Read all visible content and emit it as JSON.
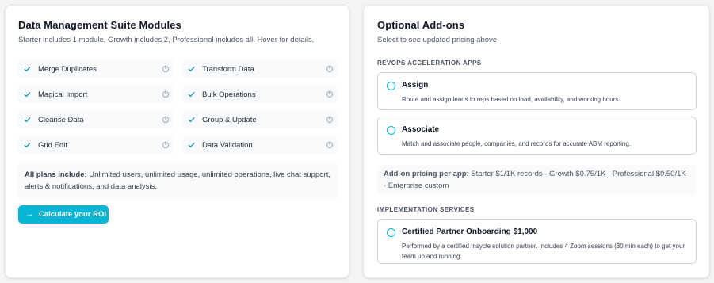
{
  "modules_card": {
    "title": "Data Management Suite Modules",
    "subtitle": "Starter includes 1 module, Growth includes 2, Professional includes all. Hover for details.",
    "modules": [
      {
        "label": "Merge Duplicates",
        "info_icon": "info-icon"
      },
      {
        "label": "Transform Data",
        "info_icon": "info-icon"
      },
      {
        "label": "Magical Import",
        "info_icon": "info-icon"
      },
      {
        "label": "Bulk Operations",
        "info_icon": "info-icon"
      },
      {
        "label": "Cleanse Data",
        "info_icon": "info-icon"
      },
      {
        "label": "Group & Update",
        "info_icon": "info-icon"
      },
      {
        "label": "Grid Edit",
        "info_icon": "info-icon"
      },
      {
        "label": "Data Validation",
        "info_icon": "info-icon"
      }
    ],
    "plans_label": "All plans include:",
    "plans_text": " Unlimited users, unlimited usage, unlimited operations, live chat support, alerts & notifications, and data analysis.",
    "roi_button": "Calculate your ROI"
  },
  "addons_card": {
    "title": "Optional Add-ons",
    "subtitle": "Select to see updated pricing above",
    "revops_heading": "REVOPS ACCELERATION APPS",
    "revops_options": [
      {
        "title": "Assign",
        "description": "Route and assign leads to reps based on load, availability, and working hours."
      },
      {
        "title": "Associate",
        "description": "Match and associate people, companies, and records for accurate ABM reporting."
      }
    ],
    "pricing_label": "Add-on pricing per app:",
    "pricing_text": " Starter $1/1K records · Growth $0.75/1K · Professional $0.50/1K · Enterprise custom",
    "impl_heading": "IMPLEMENTATION SERVICES",
    "impl_option": {
      "title": "Certified Partner Onboarding $1,000",
      "description": "Performed by a certified Insycle solution partner. Includes 4 Zoom sessions (30 min each) to get your team up and running."
    }
  },
  "colors": {
    "accent": "#06b6d4",
    "check": "#0891b2",
    "background": "#f3f4f6"
  }
}
